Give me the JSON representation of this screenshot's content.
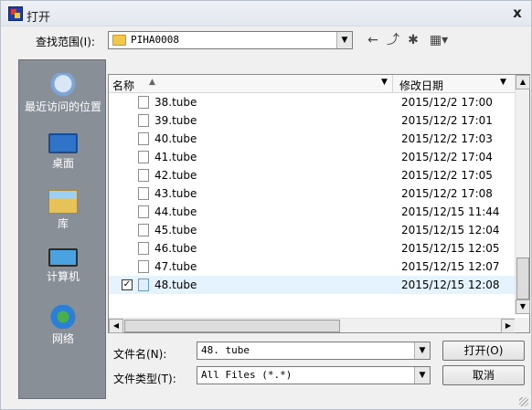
{
  "window": {
    "title": "打开",
    "close_glyph": "x"
  },
  "toolbar": {
    "lookin_label": "查找范围(I):",
    "lookin_value": "PIHA0008",
    "back_icon": "←",
    "up_icon": "⤴",
    "newfolder_icon": "✱",
    "views_icon": "▦▾"
  },
  "places": [
    {
      "label": "最近访问的位置",
      "icon": "recent-places-icon"
    },
    {
      "label": "桌面",
      "icon": "desktop-icon"
    },
    {
      "label": "库",
      "icon": "libraries-icon"
    },
    {
      "label": "计算机",
      "icon": "computer-icon"
    },
    {
      "label": "网络",
      "icon": "network-icon"
    }
  ],
  "filelist": {
    "columns": {
      "name": "名称",
      "date": "修改日期"
    },
    "files": [
      {
        "name": "38.tube",
        "date": "2015/12/2 17:00"
      },
      {
        "name": "39.tube",
        "date": "2015/12/2 17:01"
      },
      {
        "name": "40.tube",
        "date": "2015/12/2 17:03"
      },
      {
        "name": "41.tube",
        "date": "2015/12/2 17:04"
      },
      {
        "name": "42.tube",
        "date": "2015/12/2 17:05"
      },
      {
        "name": "43.tube",
        "date": "2015/12/2 17:08"
      },
      {
        "name": "44.tube",
        "date": "2015/12/15 11:44"
      },
      {
        "name": "45.tube",
        "date": "2015/12/15 12:04"
      },
      {
        "name": "46.tube",
        "date": "2015/12/15 12:05"
      },
      {
        "name": "47.tube",
        "date": "2015/12/15 12:07"
      },
      {
        "name": "48.tube",
        "date": "2015/12/15 12:08",
        "selected": true,
        "checked": true
      }
    ]
  },
  "filename": {
    "label": "文件名(N):",
    "value": "48. tube"
  },
  "filetype": {
    "label": "文件类型(T):",
    "value": "All Files (*.*)"
  },
  "buttons": {
    "open": "打开(O)",
    "cancel": "取消"
  },
  "colors": {
    "selection": "#e5f3ff",
    "places_panel": "#888f97"
  }
}
